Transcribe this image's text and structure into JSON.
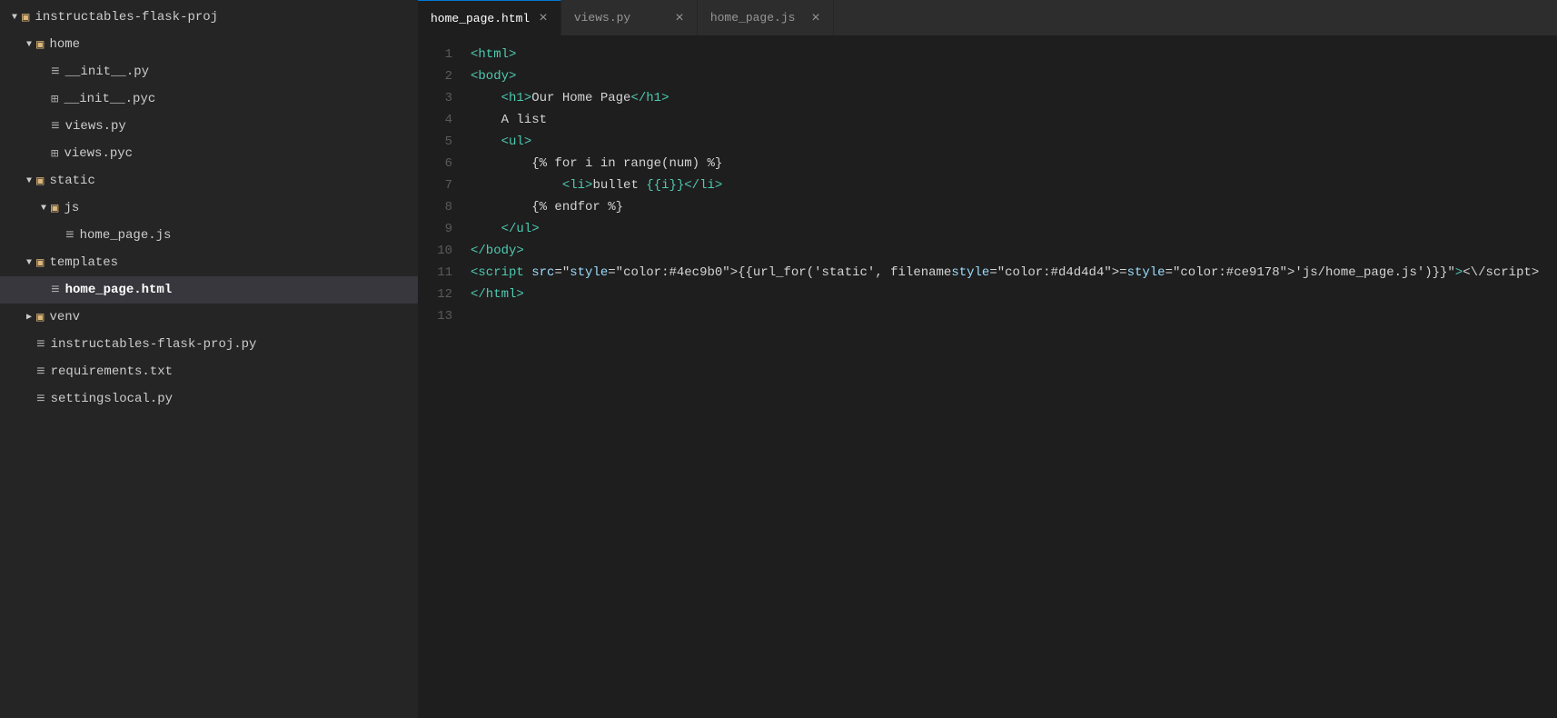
{
  "sidebar": {
    "root": {
      "label": "instructables-flask-proj",
      "expanded": true
    },
    "items": [
      {
        "id": "root",
        "label": "instructables-flask-proj",
        "level": 0,
        "type": "folder",
        "expanded": true,
        "arrow": "open"
      },
      {
        "id": "home",
        "label": "home",
        "level": 1,
        "type": "folder",
        "expanded": true,
        "arrow": "open"
      },
      {
        "id": "init_py",
        "label": "__init__.py",
        "level": 2,
        "type": "file",
        "expanded": false,
        "arrow": "empty"
      },
      {
        "id": "init_pyc",
        "label": "__init__.pyc",
        "level": 2,
        "type": "file-grid",
        "expanded": false,
        "arrow": "empty"
      },
      {
        "id": "views_py",
        "label": "views.py",
        "level": 2,
        "type": "file",
        "expanded": false,
        "arrow": "empty"
      },
      {
        "id": "views_pyc",
        "label": "views.pyc",
        "level": 2,
        "type": "file-grid",
        "expanded": false,
        "arrow": "empty"
      },
      {
        "id": "static",
        "label": "static",
        "level": 1,
        "type": "folder",
        "expanded": true,
        "arrow": "open"
      },
      {
        "id": "js",
        "label": "js",
        "level": 2,
        "type": "folder",
        "expanded": true,
        "arrow": "open"
      },
      {
        "id": "home_page_js",
        "label": "home_page.js",
        "level": 3,
        "type": "file",
        "expanded": false,
        "arrow": "empty"
      },
      {
        "id": "templates",
        "label": "templates",
        "level": 1,
        "type": "folder",
        "expanded": true,
        "arrow": "open"
      },
      {
        "id": "home_page_html",
        "label": "home_page.html",
        "level": 2,
        "type": "file",
        "expanded": false,
        "arrow": "empty",
        "active": true
      },
      {
        "id": "venv",
        "label": "venv",
        "level": 1,
        "type": "folder",
        "expanded": false,
        "arrow": "closed"
      },
      {
        "id": "flask_proj_py",
        "label": "instructables-flask-proj.py",
        "level": 1,
        "type": "file",
        "expanded": false,
        "arrow": "empty"
      },
      {
        "id": "requirements_txt",
        "label": "requirements.txt",
        "level": 1,
        "type": "file",
        "expanded": false,
        "arrow": "empty"
      },
      {
        "id": "settingslocal_py",
        "label": "settingslocal.py",
        "level": 1,
        "type": "file",
        "expanded": false,
        "arrow": "empty"
      }
    ]
  },
  "tabs": [
    {
      "id": "home_page_html",
      "label": "home_page.html",
      "active": true,
      "close": "×"
    },
    {
      "id": "views_py",
      "label": "views.py",
      "active": false,
      "close": "×"
    },
    {
      "id": "home_page_js",
      "label": "home_page.js",
      "active": false,
      "close": "×"
    }
  ],
  "code": {
    "lines": [
      {
        "num": 1,
        "content": "<html>"
      },
      {
        "num": 2,
        "content": "<body>"
      },
      {
        "num": 3,
        "content": "    <h1>Our Home Page</h1>"
      },
      {
        "num": 4,
        "content": "    A list"
      },
      {
        "num": 5,
        "content": "    <ul>"
      },
      {
        "num": 6,
        "content": "        {% for i in range(num) %}"
      },
      {
        "num": 7,
        "content": "            <li>bullet {{i}}</li>"
      },
      {
        "num": 8,
        "content": "        {% endfor %}"
      },
      {
        "num": 9,
        "content": "    </ul>"
      },
      {
        "num": 10,
        "content": "</body>"
      },
      {
        "num": 11,
        "content": "<script src=\"{{url_for('static', filename='js/home_page.js')}}\"><\\/script>"
      },
      {
        "num": 12,
        "content": "</html>"
      },
      {
        "num": 13,
        "content": ""
      }
    ]
  }
}
